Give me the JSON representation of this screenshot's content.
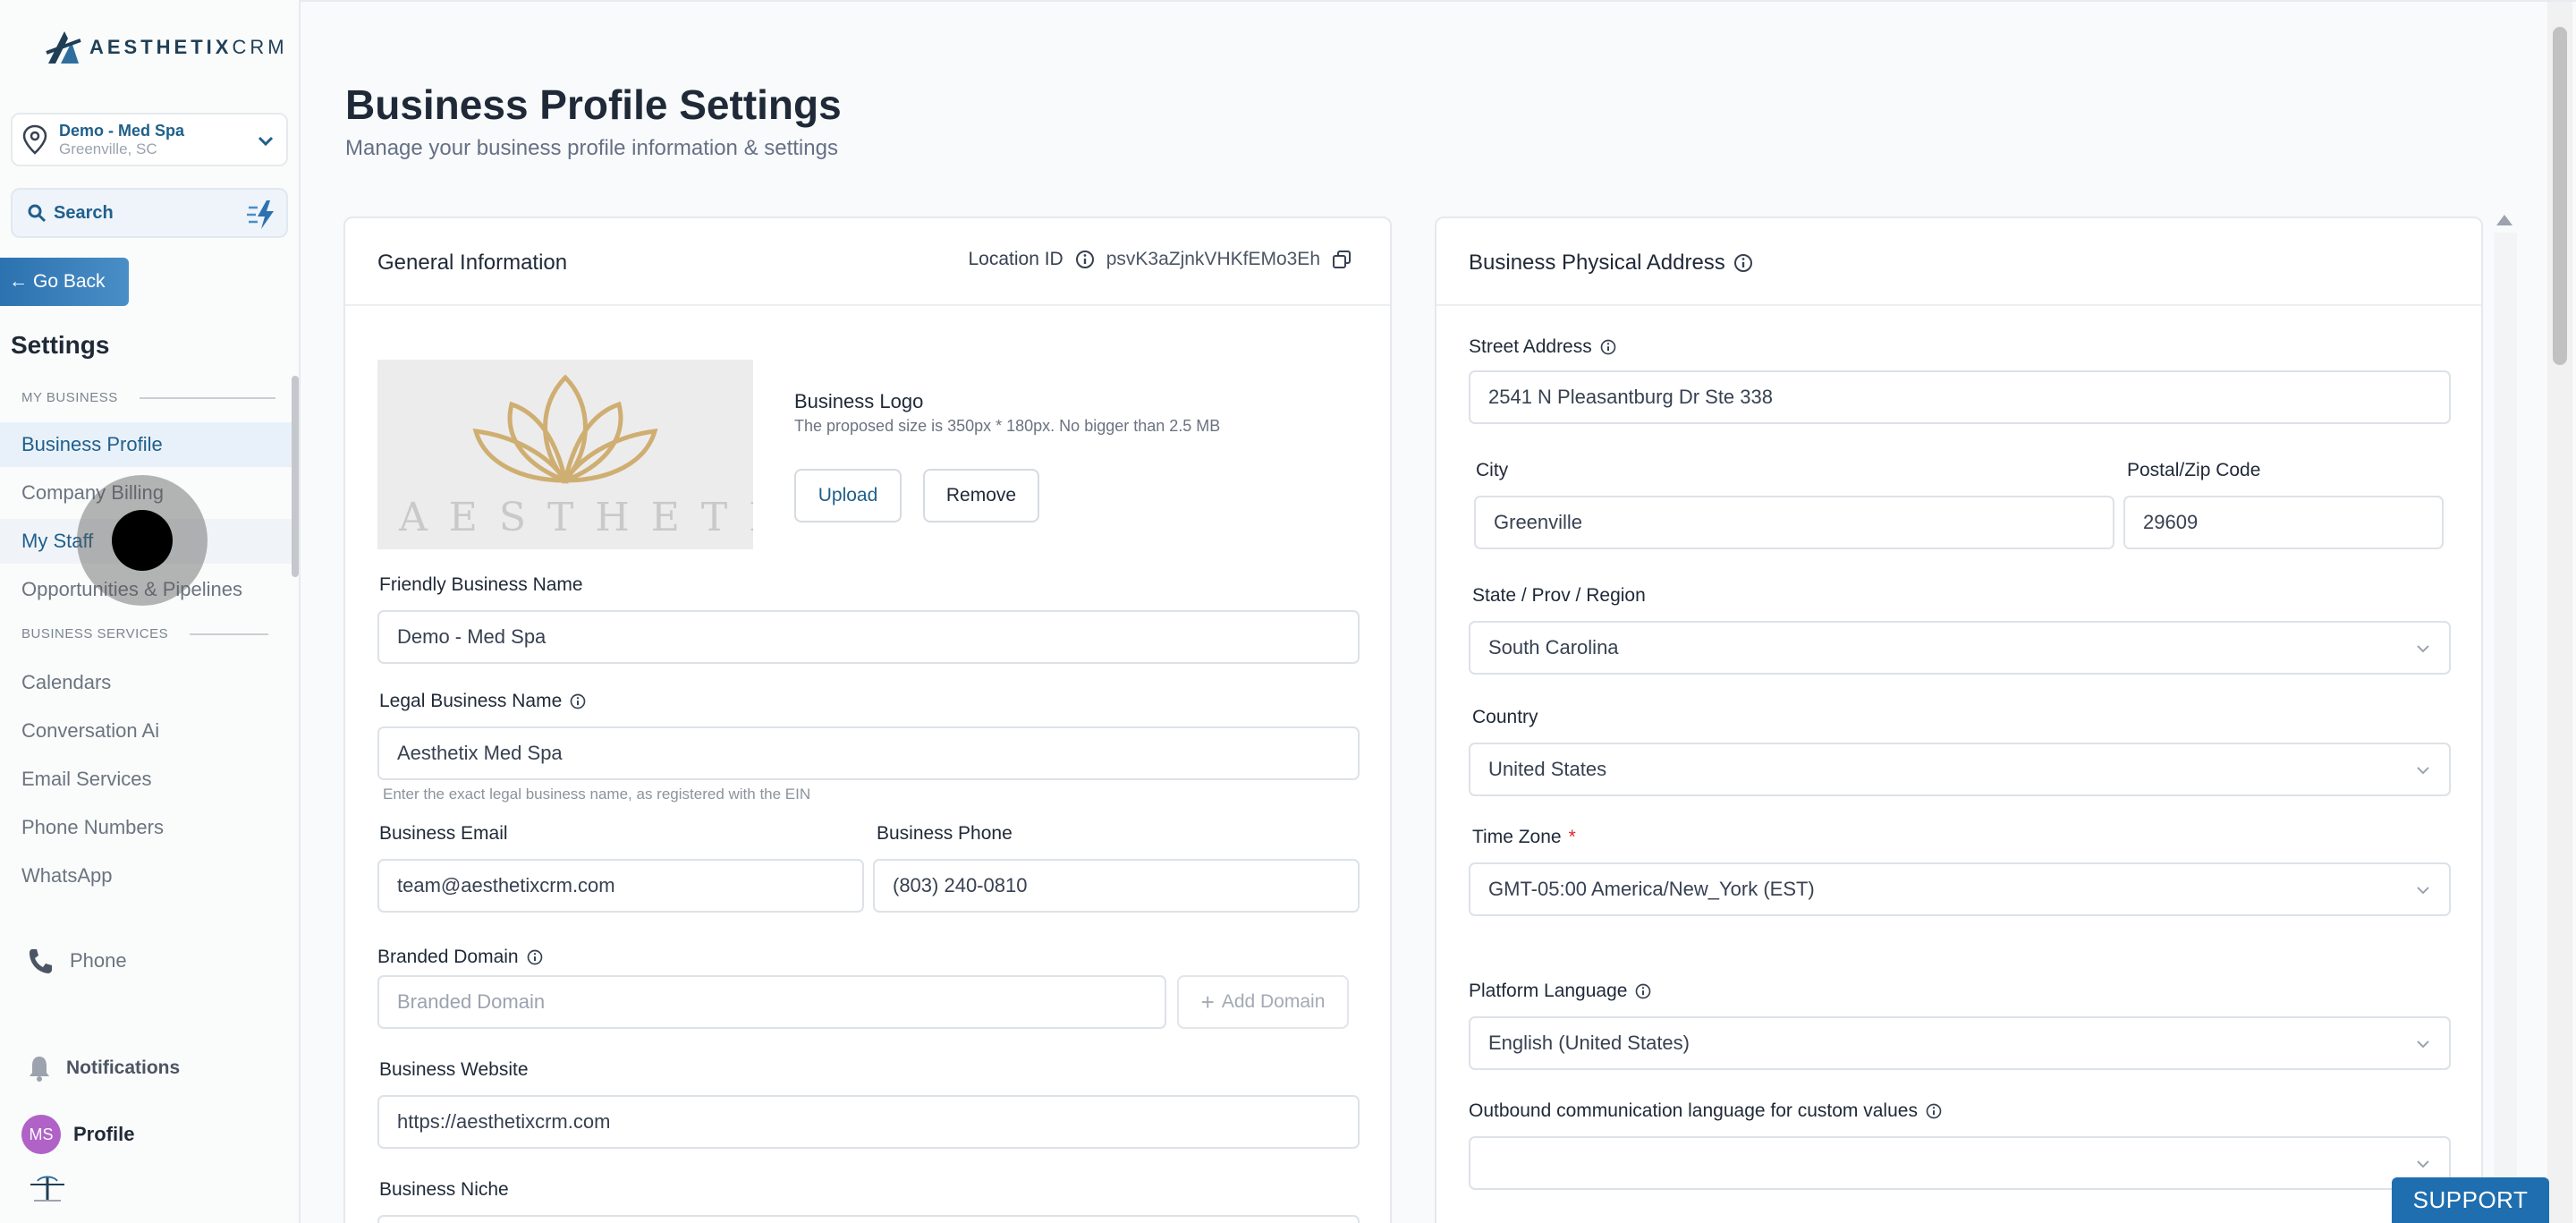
{
  "sidebar": {
    "logo_text_bold": "AESTHETIX",
    "logo_text_thin": "CRM",
    "location": {
      "name": "Demo - Med Spa",
      "city": "Greenville, SC"
    },
    "search_label": "Search",
    "go_back": "Go Back",
    "settings_title": "Settings",
    "groups": [
      {
        "title": "MY BUSINESS"
      },
      {
        "title": "BUSINESS SERVICES"
      }
    ],
    "items": [
      {
        "label": "Business Profile"
      },
      {
        "label": "Company Billing"
      },
      {
        "label": "My Staff"
      },
      {
        "label": "Opportunities & Pipelines"
      },
      {
        "label": "Calendars"
      },
      {
        "label": "Conversation Ai"
      },
      {
        "label": "Email Services"
      },
      {
        "label": "Phone Numbers"
      },
      {
        "label": "WhatsApp"
      }
    ],
    "phone": "Phone",
    "notifications": "Notifications",
    "profile": {
      "initials": "MS",
      "label": "Profile"
    }
  },
  "page": {
    "title": "Business Profile Settings",
    "subtitle": "Manage your business profile information & settings"
  },
  "general": {
    "title": "General Information",
    "location_id_label": "Location ID",
    "location_id": "psvK3aZjnkVHKfEMo3Eh",
    "logo_brand": "AESTHETIX",
    "logo_title": "Business Logo",
    "logo_hint": "The proposed size is 350px * 180px. No bigger than 2.5 MB",
    "upload": "Upload",
    "remove": "Remove",
    "friendly_name_label": "Friendly Business Name",
    "friendly_name": "Demo - Med Spa",
    "legal_name_label": "Legal Business Name",
    "legal_name": "Aesthetix Med Spa",
    "legal_hint": "Enter the exact legal business name, as registered with the EIN",
    "email_label": "Business Email",
    "email": "team@aesthetixcrm.com",
    "phone_label": "Business Phone",
    "phone": "(803) 240-0810",
    "domain_label": "Branded Domain",
    "domain_placeholder": "Branded Domain",
    "add_domain": "Add Domain",
    "website_label": "Business Website",
    "website": "https://aesthetixcrm.com",
    "niche_label": "Business Niche"
  },
  "address": {
    "title": "Business Physical Address",
    "street_label": "Street Address",
    "street": "2541 N Pleasantburg Dr Ste 338",
    "city_label": "City",
    "city": "Greenville",
    "zip_label": "Postal/Zip Code",
    "zip": "29609",
    "state_label": "State / Prov / Region",
    "state": "South Carolina",
    "country_label": "Country",
    "country": "United States",
    "tz_label": "Time Zone",
    "tz_required": "*",
    "tz": "GMT-05:00 America/New_York (EST)",
    "lang_label": "Platform Language",
    "lang": "English (United States)",
    "outbound_label": "Outbound communication language for custom values",
    "outbound": ""
  },
  "support": "SUPPORT",
  "colors": {
    "accent": "#1f5f8b",
    "support": "#1f6fb0",
    "avatar": "#b062c7"
  }
}
